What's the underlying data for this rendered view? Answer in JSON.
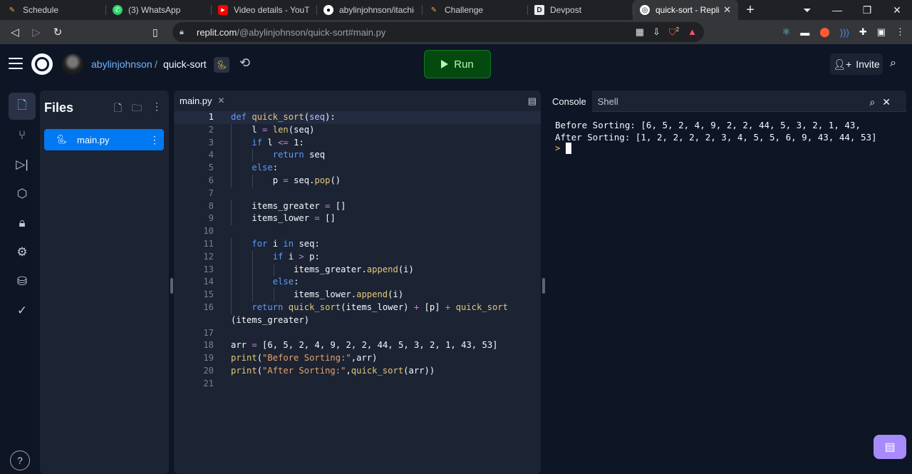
{
  "browser": {
    "tabs": [
      {
        "title": "Schedule",
        "icon": "ruler-icon"
      },
      {
        "title": "(3) WhatsApp",
        "icon": "whatsapp-icon"
      },
      {
        "title": "Video details - YouTube",
        "icon": "youtube-icon"
      },
      {
        "title": "abylinjohnson/itachi-u",
        "icon": "github-icon"
      },
      {
        "title": "Challenge",
        "icon": "ruler-icon"
      },
      {
        "title": "Devpost",
        "icon": "devpost-icon"
      },
      {
        "title": "quick-sort - Replit",
        "icon": "replit-icon",
        "active": true
      }
    ],
    "new_tab": "+",
    "url_host": "replit.com",
    "url_path": "/@abylinjohnson/quick-sort#main.py",
    "brave_badge": "2"
  },
  "header": {
    "owner": "abylinjohnson",
    "separator": "/",
    "repl_name": "quick-sort",
    "run_label": "Run",
    "invite_label": "Invite"
  },
  "files": {
    "title": "Files",
    "items": [
      {
        "name": "main.py",
        "selected": true
      }
    ]
  },
  "editor": {
    "tab_label": "main.py",
    "current_line": 1,
    "lines": [
      "def quick_sort(seq):",
      "    l = len(seq)",
      "    if l <= 1:",
      "        return seq",
      "    else:",
      "        p = seq.pop()",
      "",
      "    items_greater = []",
      "    items_lower = []",
      "",
      "    for i in seq:",
      "        if i > p:",
      "            items_greater.append(i)",
      "        else:",
      "            items_lower.append(i)",
      "    return quick_sort(items_lower) + [p] + quick_sort",
      "(items_greater)",
      "",
      "arr = [6, 5, 2, 4, 9, 2, 2, 44, 5, 3, 2, 1, 43, 53]",
      "print(\"Before Sorting:\",arr)",
      "print(\"After Sorting:\",quick_sort(arr))",
      ""
    ],
    "line_numbers": [
      "1",
      "2",
      "3",
      "4",
      "5",
      "6",
      "7",
      "8",
      "9",
      "10",
      "11",
      "12",
      "13",
      "14",
      "15",
      "16",
      "",
      "17",
      "18",
      "19",
      "20",
      "21"
    ]
  },
  "console": {
    "tabs": [
      "Console",
      "Shell"
    ],
    "active_tab": "Console",
    "output": [
      "Before Sorting: [6, 5, 2, 4, 9, 2, 2, 44, 5, 3, 2, 1, 43,",
      "After Sorting: [1, 2, 2, 2, 2, 3, 4, 5, 5, 6, 9, 43, 44, 53]"
    ],
    "prompt": ">"
  },
  "colors": {
    "accent": "#0079f2",
    "run_bg": "#044a10",
    "bg": "#0e1525",
    "panel": "#1c2333"
  }
}
